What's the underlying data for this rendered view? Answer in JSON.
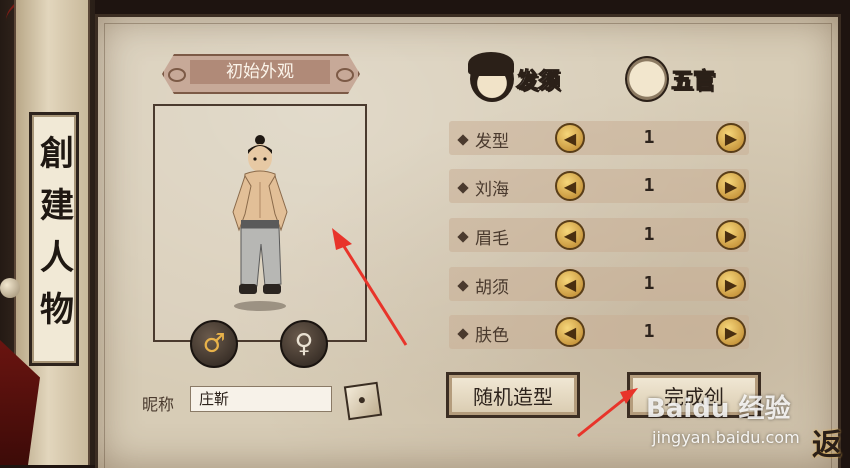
{
  "sidebar": {
    "title": "創建人物"
  },
  "preview": {
    "header": "初始外观",
    "gender": {
      "male_icon": "male-symbol-icon",
      "female_icon": "female-symbol-icon"
    }
  },
  "nickname": {
    "label": "昵称",
    "value": "庄靳"
  },
  "tabs": [
    {
      "label": "发须",
      "icon": "hair-avatar-icon"
    },
    {
      "label": "五官",
      "icon": "face-avatar-icon"
    }
  ],
  "options": [
    {
      "label": "发型",
      "value": "1"
    },
    {
      "label": "刘海",
      "value": "1"
    },
    {
      "label": "眉毛",
      "value": "1"
    },
    {
      "label": "胡须",
      "value": "1"
    },
    {
      "label": "肤色",
      "value": "1"
    }
  ],
  "actions": {
    "random": "随机造型",
    "done": "完成创"
  },
  "watermark": {
    "brand": "Baidu 经验",
    "url": "jingyan.baidu.com"
  },
  "corner": {
    "back_glyph": "返"
  },
  "colors": {
    "parchment": "#d7ccb6",
    "gold_arrow": "#e8b24a",
    "annotation": "#e8342a"
  }
}
